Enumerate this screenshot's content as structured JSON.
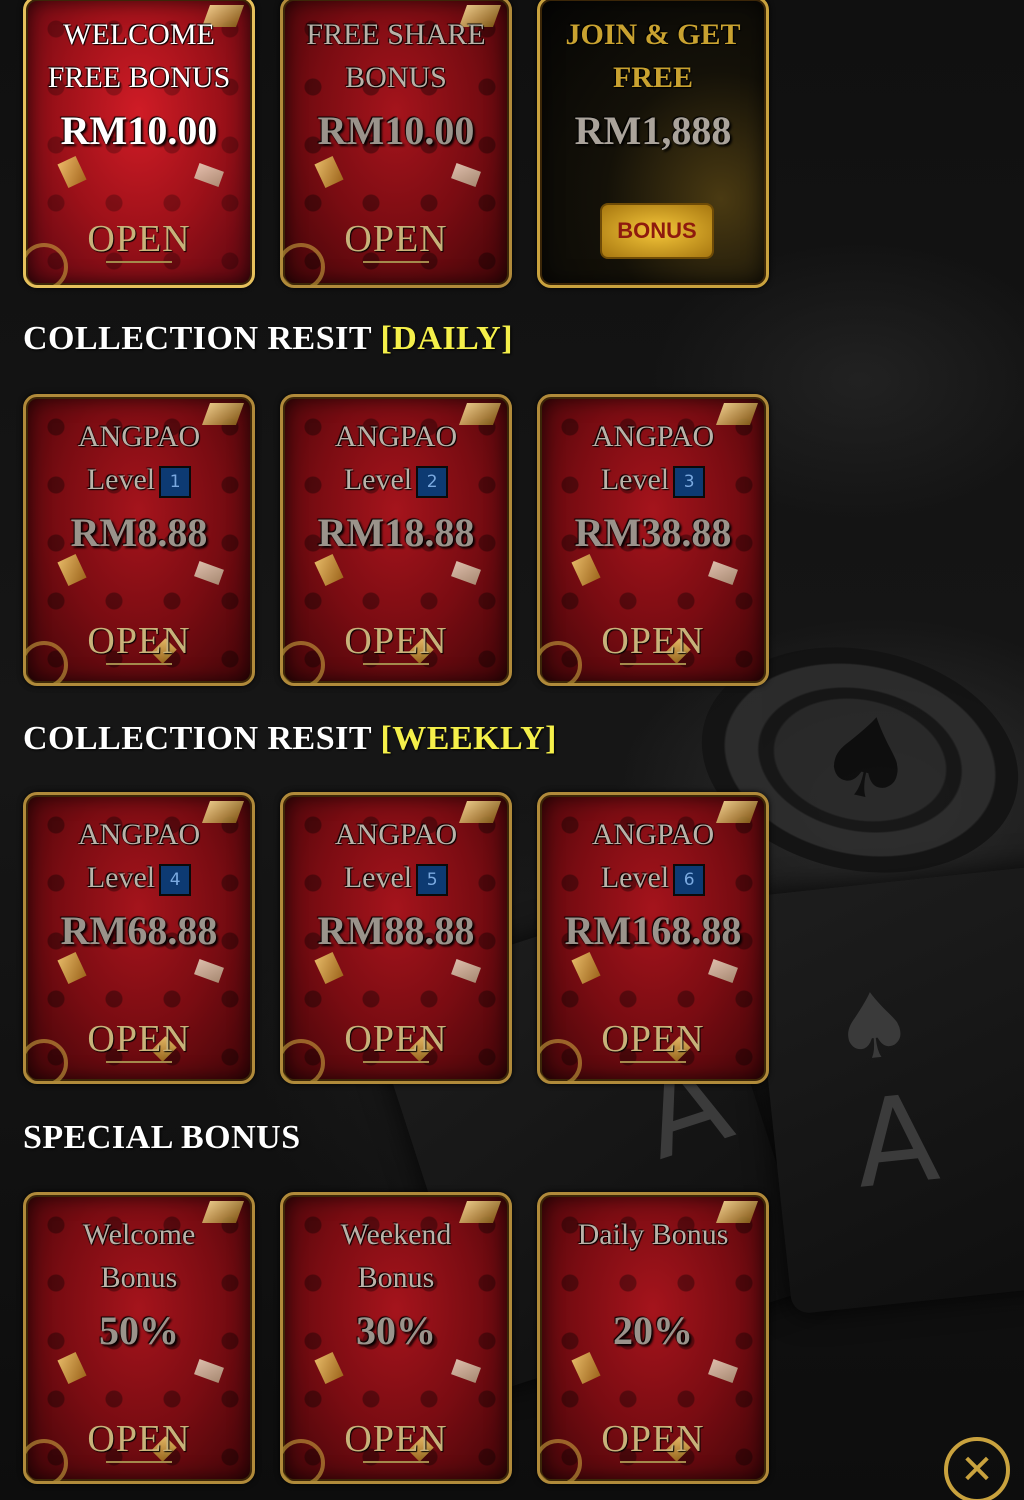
{
  "top_row": [
    {
      "title": "WELCOME FREE BONUS",
      "amount": "RM10.00",
      "action": "OPEN"
    },
    {
      "title": "FREE SHARE BONUS",
      "amount": "RM10.00",
      "action": "OPEN"
    },
    {
      "title": "JOIN & GET FREE",
      "amount": "RM1,888",
      "badge": "BONUS"
    }
  ],
  "daily": {
    "title": "COLLECTION RESIT",
    "tag": "[DAILY]",
    "cards": [
      {
        "name": "ANGPAO",
        "level_label": "Level",
        "level": "1",
        "amount": "RM8.88",
        "action": "OPEN"
      },
      {
        "name": "ANGPAO",
        "level_label": "Level",
        "level": "2",
        "amount": "RM18.88",
        "action": "OPEN"
      },
      {
        "name": "ANGPAO",
        "level_label": "Level",
        "level": "3",
        "amount": "RM38.88",
        "action": "OPEN"
      }
    ]
  },
  "weekly": {
    "title": "COLLECTION RESIT",
    "tag": "[WEEKLY]",
    "cards": [
      {
        "name": "ANGPAO",
        "level_label": "Level",
        "level": "4",
        "amount": "RM68.88",
        "action": "OPEN"
      },
      {
        "name": "ANGPAO",
        "level_label": "Level",
        "level": "5",
        "amount": "RM88.88",
        "action": "OPEN"
      },
      {
        "name": "ANGPAO",
        "level_label": "Level",
        "level": "6",
        "amount": "RM168.88",
        "action": "OPEN"
      }
    ]
  },
  "special": {
    "title": "SPECIAL BONUS",
    "cards": [
      {
        "line1": "Welcome",
        "line2": "Bonus",
        "amount": "50%",
        "action": "OPEN"
      },
      {
        "line1": "Weekend",
        "line2": "Bonus",
        "amount": "30%",
        "action": "OPEN"
      },
      {
        "line1": "Daily Bonus",
        "line2": "",
        "amount": "20%",
        "action": "OPEN"
      }
    ]
  },
  "close_icon": "close-icon",
  "colors": {
    "accent_yellow": "#f5f04a",
    "gold": "#c9a23e",
    "card_red": "#9d1119",
    "level_blue": "#0d3a72"
  }
}
